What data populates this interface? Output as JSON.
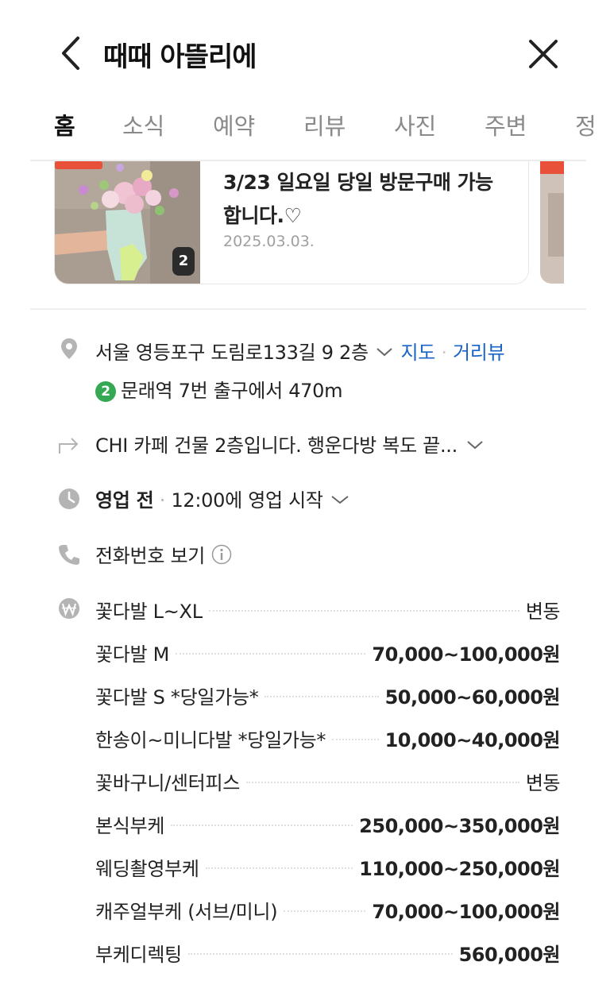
{
  "header": {
    "title": "때때 아뜰리에"
  },
  "tabs": [
    {
      "label": "홈",
      "active": true
    },
    {
      "label": "소식",
      "active": false
    },
    {
      "label": "예약",
      "active": false
    },
    {
      "label": "리뷰",
      "active": false
    },
    {
      "label": "사진",
      "active": false
    },
    {
      "label": "주변",
      "active": false
    },
    {
      "label": "정",
      "active": false
    }
  ],
  "news": {
    "title": "3/23 일요일 당일 방문구매 가능합니다.♡",
    "date": "2025.03.03.",
    "image_count": "2"
  },
  "info": {
    "address": "서울 영등포구 도림로133길 9 2층",
    "map_link": "지도",
    "street_view_link": "거리뷰",
    "subway_line": "2",
    "subway_text": "문래역 7번 출구에서 470m",
    "directions": "CHI 카페 건물 2층입니다. 행운다방 복도 끝...",
    "hours_status": "영업 전",
    "hours_detail": "12:00에 영업 시작",
    "phone": "전화번호 보기"
  },
  "prices": [
    {
      "name": "꽃다발 L~XL",
      "price": "변동"
    },
    {
      "name": "꽃다발 M",
      "price": "70,000~100,000원"
    },
    {
      "name": "꽃다발 S *당일가능*",
      "price": "50,000~60,000원"
    },
    {
      "name": "한송이~미니다발 *당일가능*",
      "price": "10,000~40,000원"
    },
    {
      "name": "꽃바구니/센터피스",
      "price": "변동"
    },
    {
      "name": "본식부케",
      "price": "250,000~350,000원"
    },
    {
      "name": "웨딩촬영부케",
      "price": "110,000~250,000원"
    },
    {
      "name": "캐주얼부케 (서브/미니)",
      "price": "70,000~100,000원"
    },
    {
      "name": "부케디렉팅",
      "price": "560,000원"
    }
  ],
  "colors": {
    "link": "#1a64c8",
    "subway_line_2": "#34a853",
    "icon_gray": "#b4b4b4"
  }
}
